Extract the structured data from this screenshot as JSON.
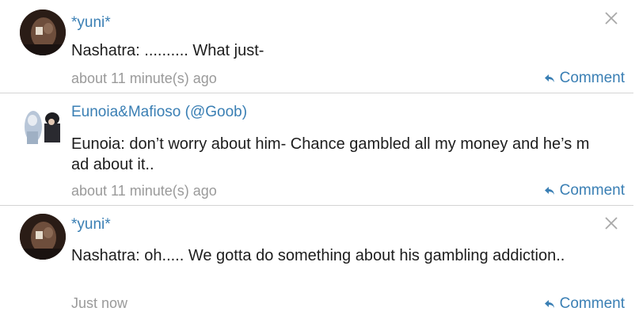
{
  "comments": [
    {
      "username": "*yuni*",
      "text": "Nashatra: .......... What just-",
      "time": "about 11 minute(s) ago",
      "reply_label": "Comment",
      "has_close": true
    },
    {
      "username": "Eunoia&Mafioso (@Goob)",
      "text": "Eunoia: don’t worry about him- Chance gambled all my money and he’s mad about it..",
      "time": "about 11 minute(s) ago",
      "reply_label": "Comment",
      "has_close": false
    },
    {
      "username": "*yuni*",
      "text": "Nashatra: oh..... We gotta do something about his gambling addiction..",
      "time": "Just now",
      "reply_label": "Comment",
      "has_close": true
    }
  ],
  "colors": {
    "link": "#3a7fb4",
    "text": "#1d1d1d",
    "muted": "#9a9a9a",
    "divider": "#d4d4d4"
  },
  "icons": {
    "reply": "reply-arrow-icon",
    "close": "close-icon"
  }
}
